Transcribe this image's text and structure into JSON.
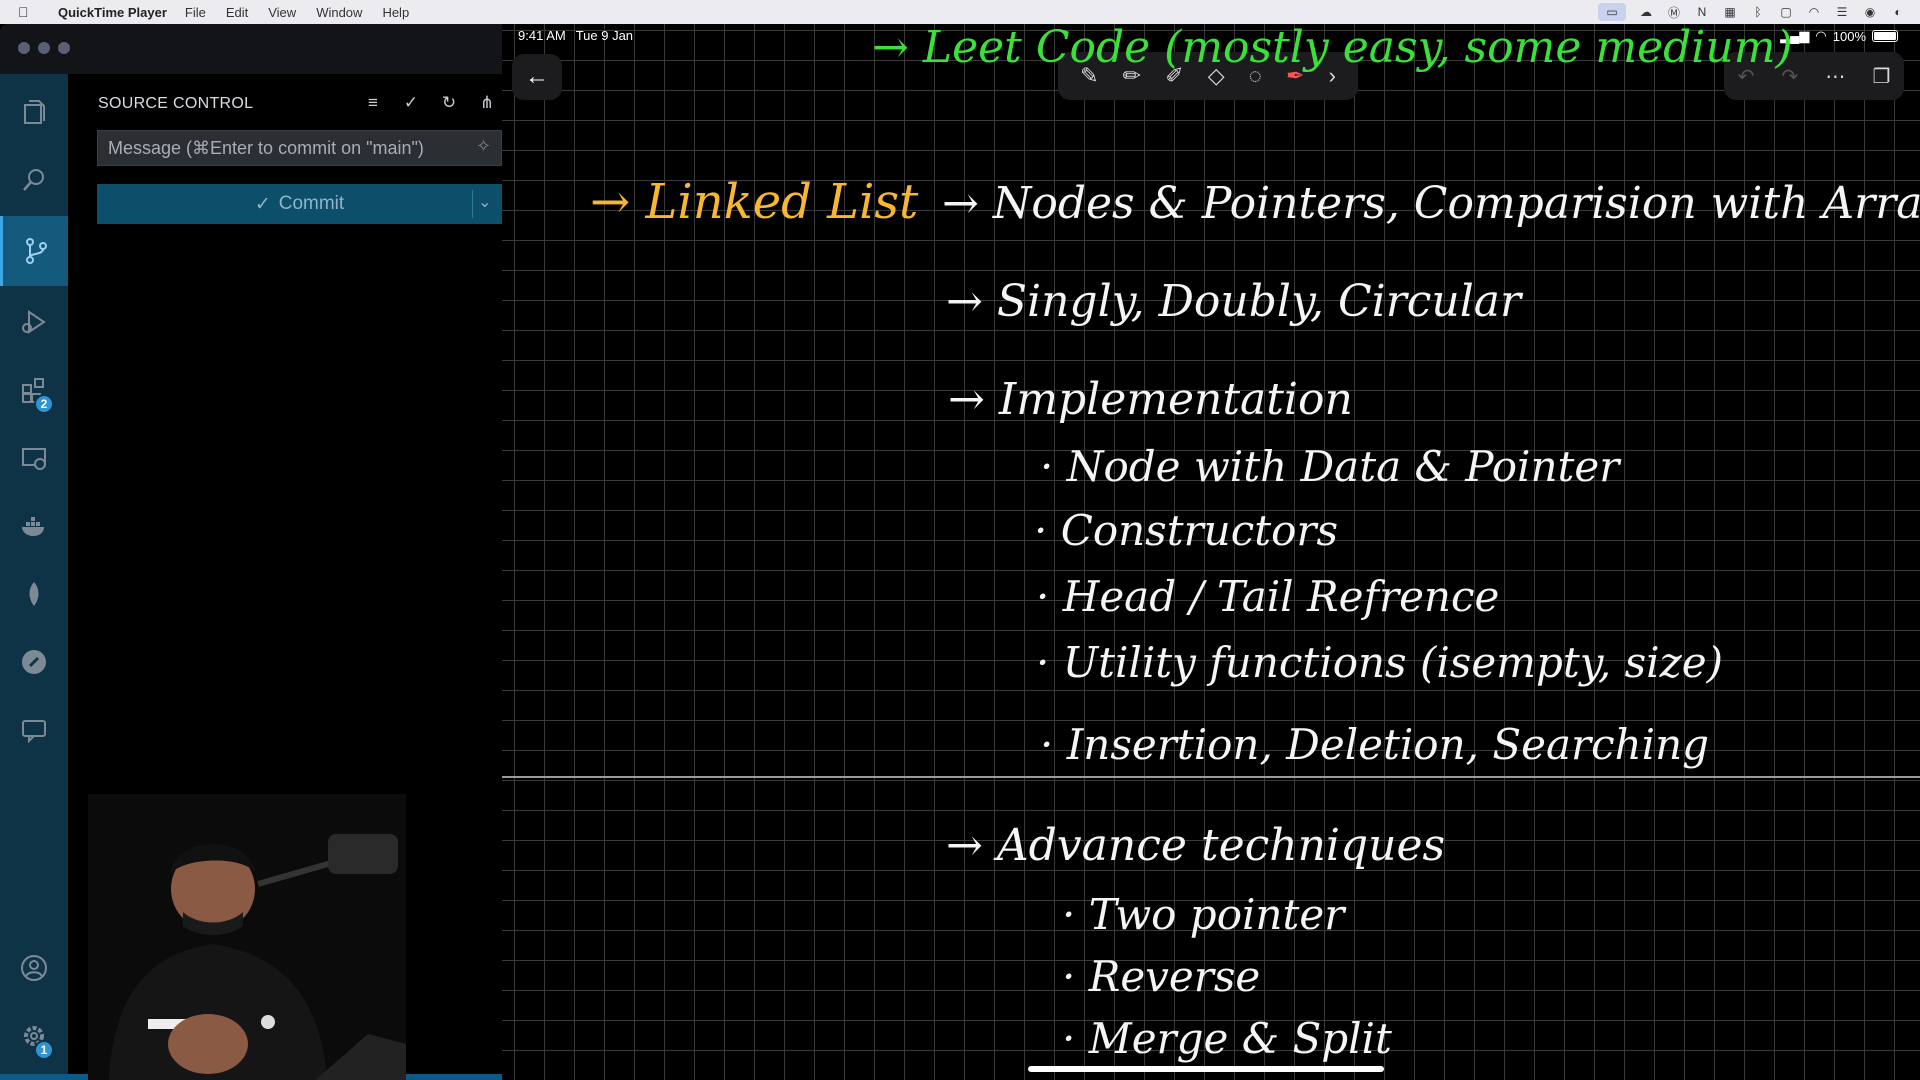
{
  "menubar": {
    "app_name": "QuickTime Player",
    "items": [
      "File",
      "Edit",
      "View",
      "Window",
      "Help"
    ]
  },
  "vscode": {
    "panel_title": "SOURCE CONTROL",
    "message_placeholder": "Message (⌘Enter to commit on \"main\")",
    "commit_label": "Commit",
    "extensions_badge": "2",
    "settings_badge": "1"
  },
  "ipad": {
    "time": "9:41 AM",
    "date": "Tue 9 Jan",
    "battery": "100%"
  },
  "notes": {
    "top_line": "→ Leet Code (mostly easy, some medium)",
    "topic": "→ Linked List",
    "line1": "→ Nodes & Pointers, Comparision with Array",
    "line2": "→ Singly, Doubly, Circular",
    "line3": "→ Implementation",
    "sub1": "· Node with Data & Pointer",
    "sub2": "· Constructors",
    "sub3": "· Head / Tail Refrence",
    "sub4": "· Utility functions (isempty, size)",
    "sub5": "· Insertion, Deletion, Searching",
    "line4": "→ Advance techniques",
    "sub6": "· Two pointer",
    "sub7": "· Reverse",
    "sub8": "· Merge & Split"
  },
  "colors": {
    "activity_bar": "#0f3346",
    "commit_button": "#0d4f6b",
    "ink_green": "#3be03b",
    "ink_yellow": "#f7b733"
  }
}
